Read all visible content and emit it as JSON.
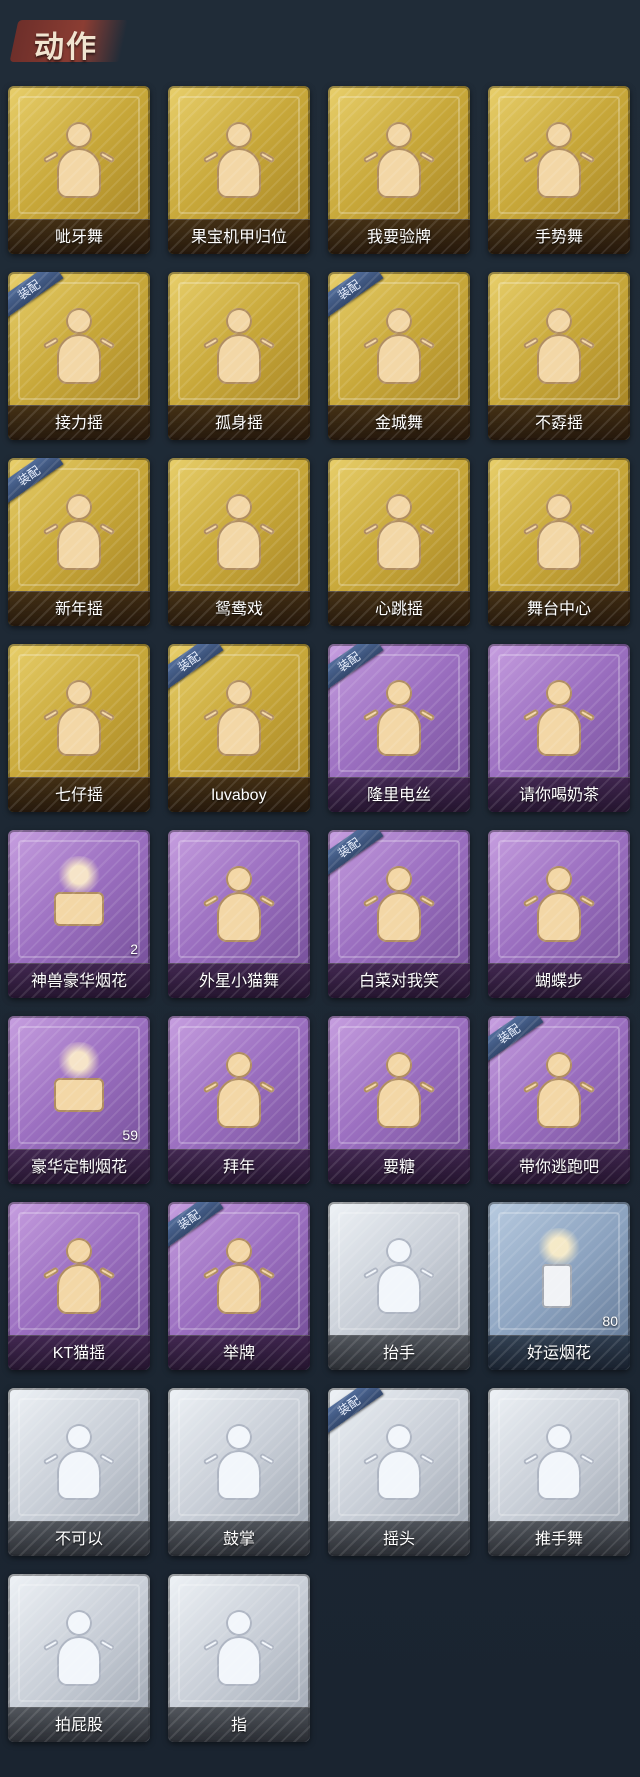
{
  "header": {
    "title": "动作"
  },
  "actions": [
    {
      "label": "呲牙舞",
      "equipped": false,
      "count": ""
    },
    {
      "label": "果宝机甲归位",
      "equipped": false,
      "count": ""
    },
    {
      "label": "我要验牌",
      "equipped": false,
      "count": ""
    },
    {
      "label": "手势舞",
      "equipped": false,
      "count": ""
    },
    {
      "label": "接力摇",
      "equipped": true,
      "count": ""
    },
    {
      "label": "孤身摇",
      "equipped": false,
      "count": ""
    },
    {
      "label": "金城舞",
      "equipped": true,
      "count": ""
    },
    {
      "label": "不孬摇",
      "equipped": false,
      "count": ""
    },
    {
      "label": "新年摇",
      "equipped": true,
      "count": ""
    },
    {
      "label": "鸳鸯戏",
      "equipped": false,
      "count": ""
    },
    {
      "label": "心跳摇",
      "equipped": false,
      "count": ""
    },
    {
      "label": "舞台中心",
      "equipped": false,
      "count": ""
    },
    {
      "label": "七仔摇",
      "equipped": false,
      "count": ""
    },
    {
      "label": "luvaboy",
      "equipped": true,
      "count": ""
    },
    {
      "label": "隆里电丝",
      "equipped": true,
      "count": ""
    },
    {
      "label": "请你喝奶茶",
      "equipped": false,
      "count": ""
    },
    {
      "label": "神兽豪华烟花",
      "equipped": false,
      "count": "2"
    },
    {
      "label": "外星小猫舞",
      "equipped": false,
      "count": ""
    },
    {
      "label": "白菜对我笑",
      "equipped": true,
      "count": ""
    },
    {
      "label": "蝴蝶步",
      "equipped": false,
      "count": ""
    },
    {
      "label": "豪华定制烟花",
      "equipped": false,
      "count": "59"
    },
    {
      "label": "拜年",
      "equipped": false,
      "count": ""
    },
    {
      "label": "要糖",
      "equipped": false,
      "count": ""
    },
    {
      "label": "带你逃跑吧",
      "equipped": true,
      "count": ""
    },
    {
      "label": "KT猫摇",
      "equipped": false,
      "count": ""
    },
    {
      "label": "举牌",
      "equipped": true,
      "count": ""
    },
    {
      "label": "抬手",
      "equipped": false,
      "count": ""
    },
    {
      "label": "好运烟花",
      "equipped": false,
      "count": "80"
    },
    {
      "label": "不可以",
      "equipped": false,
      "count": ""
    },
    {
      "label": "鼓掌",
      "equipped": false,
      "count": ""
    },
    {
      "label": "摇头",
      "equipped": true,
      "count": ""
    },
    {
      "label": "推手舞",
      "equipped": false,
      "count": ""
    },
    {
      "label": "拍屁股",
      "equipped": false,
      "count": ""
    },
    {
      "label": "指",
      "equipped": false,
      "count": ""
    }
  ],
  "badge_text": "装配",
  "colors": {
    "gold": "#c8a83a",
    "purple": "#9b6fc0",
    "silver": "#c7cdd6",
    "blue": "#8ba2bf",
    "badge": "#3d5680"
  }
}
